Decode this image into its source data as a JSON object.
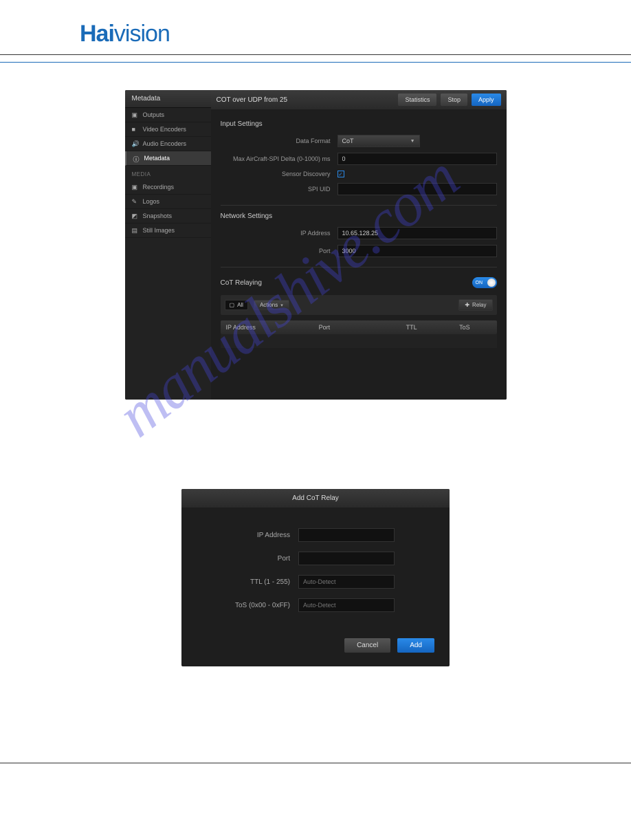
{
  "brand": {
    "part1": "Hai",
    "part2": "vision"
  },
  "watermark": "manualshive.com",
  "panel": {
    "sidebarTitle": "Metadata",
    "title": "COT over UDP from 25",
    "buttons": {
      "stats": "Statistics",
      "stop": "Stop",
      "apply": "Apply"
    },
    "nav": {
      "items": [
        {
          "label": "Outputs"
        },
        {
          "label": "Video Encoders"
        },
        {
          "label": "Audio Encoders"
        },
        {
          "label": "Metadata"
        }
      ],
      "mediaLabel": "MEDIA",
      "media": [
        {
          "label": "Recordings"
        },
        {
          "label": "Logos"
        },
        {
          "label": "Snapshots"
        },
        {
          "label": "Still Images"
        }
      ]
    },
    "sections": {
      "input": {
        "title": "Input Settings",
        "dataFormatLabel": "Data Format",
        "dataFormatValue": "CoT",
        "maxDeltaLabel": "Max AirCraft-SPI Delta (0-1000) ms",
        "maxDeltaValue": "0",
        "sensorDiscoveryLabel": "Sensor Discovery",
        "spiUidLabel": "SPI UID",
        "spiUidValue": ""
      },
      "network": {
        "title": "Network Settings",
        "ipLabel": "IP Address",
        "ipValue": "10.65.128.25",
        "portLabel": "Port",
        "portValue": "3000"
      },
      "relay": {
        "title": "CoT Relaying",
        "toggle": "ON",
        "all": "All",
        "actions": "Actions",
        "relayBtn": "Relay",
        "cols": {
          "ip": "IP Address",
          "port": "Port",
          "ttl": "TTL",
          "tos": "ToS"
        }
      }
    }
  },
  "dialog": {
    "title": "Add CoT Relay",
    "ipLabel": "IP Address",
    "portLabel": "Port",
    "ttlLabel": "TTL (1 - 255)",
    "ttlPlaceholder": "Auto-Detect",
    "tosLabel": "ToS (0x00 - 0xFF)",
    "tosPlaceholder": "Auto-Detect",
    "cancel": "Cancel",
    "add": "Add"
  }
}
